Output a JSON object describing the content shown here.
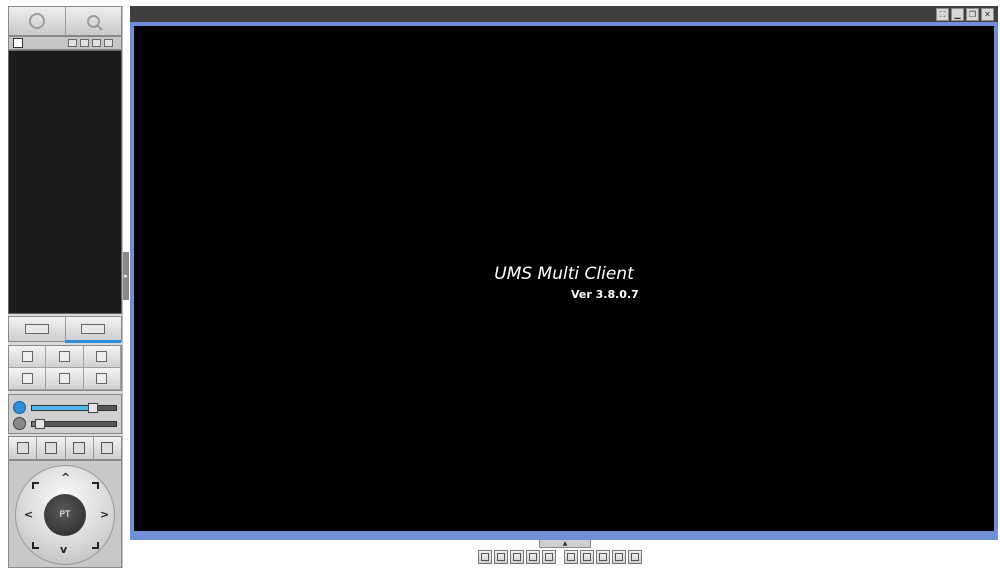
{
  "app": {
    "title": "UMS Multi Client",
    "version": "Ver 3.8.0.7"
  },
  "left_panel": {
    "tabs": [
      {
        "icon": "settings-icon"
      },
      {
        "icon": "search-icon"
      }
    ],
    "ptz_center_label": "PT"
  },
  "viewer": {
    "bottom_tab_label": "▲",
    "window_controls": [
      "fullscreen-icon",
      "minimize-icon",
      "restore-icon",
      "close-icon"
    ]
  },
  "colors": {
    "viewer_border": "#6f8fd8",
    "screen": "#000000",
    "accent": "#2e8fd8",
    "slider_fill": "#4fb6f2"
  },
  "sliders": {
    "volume_level": 0.72,
    "speed_level": 0.08
  }
}
